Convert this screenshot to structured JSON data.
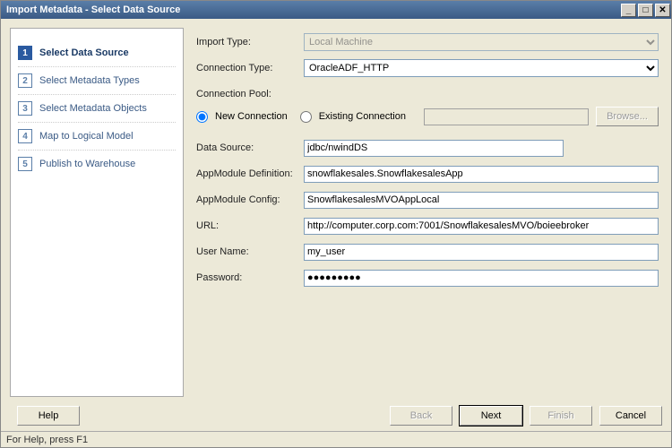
{
  "window": {
    "title": "Import Metadata - Select Data Source"
  },
  "sidebar": {
    "steps": [
      {
        "num": "1",
        "label": "Select Data Source",
        "active": true
      },
      {
        "num": "2",
        "label": "Select Metadata Types",
        "active": false
      },
      {
        "num": "3",
        "label": "Select Metadata Objects",
        "active": false
      },
      {
        "num": "4",
        "label": "Map to Logical Model",
        "active": false
      },
      {
        "num": "5",
        "label": "Publish to Warehouse",
        "active": false
      }
    ]
  },
  "form": {
    "import_type_label": "Import Type:",
    "import_type_value": "Local Machine",
    "connection_type_label": "Connection Type:",
    "connection_type_value": "OracleADF_HTTP",
    "connection_pool_label": "Connection Pool:",
    "new_connection_label": "New Connection",
    "existing_connection_label": "Existing Connection",
    "browse_label": "Browse...",
    "data_source_label": "Data Source:",
    "data_source_value": "jdbc/nwindDS",
    "appmodule_def_label": "AppModule Definition:",
    "appmodule_def_value": "snowflakesales.SnowflakesalesApp",
    "appmodule_config_label": "AppModule Config:",
    "appmodule_config_value": "SnowflakesalesMVOAppLocal",
    "url_label": "URL:",
    "url_value": "http://computer.corp.com:7001/SnowflakesalesMVO/boieebroker",
    "username_label": "User Name:",
    "username_value": "my_user",
    "password_label": "Password:",
    "password_value": "●●●●●●●●●"
  },
  "footer": {
    "help": "Help",
    "back": "Back",
    "next": "Next",
    "finish": "Finish",
    "cancel": "Cancel"
  },
  "status": {
    "text": "For Help, press F1"
  }
}
